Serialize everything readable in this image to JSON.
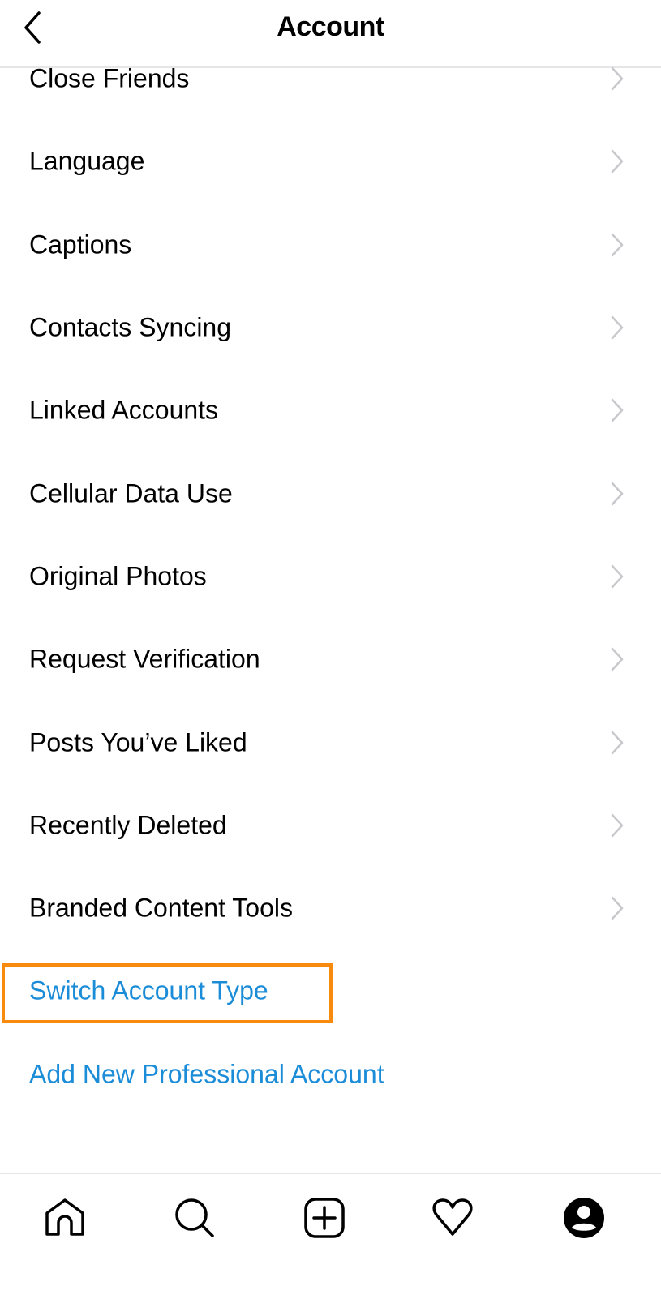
{
  "header": {
    "title": "Account",
    "back_icon": "chevron-left-icon"
  },
  "menu": {
    "items": [
      {
        "label": "Close Friends"
      },
      {
        "label": "Language"
      },
      {
        "label": "Captions"
      },
      {
        "label": "Contacts Syncing"
      },
      {
        "label": "Linked Accounts"
      },
      {
        "label": "Cellular Data Use"
      },
      {
        "label": "Original Photos"
      },
      {
        "label": "Request Verification"
      },
      {
        "label": "Posts You’ve Liked"
      },
      {
        "label": "Recently Deleted"
      },
      {
        "label": "Branded Content Tools"
      }
    ],
    "links": [
      {
        "label": "Switch Account Type",
        "highlighted": true
      },
      {
        "label": "Add New Professional Account"
      }
    ]
  },
  "colors": {
    "link": "#1a8cd8",
    "highlight_border": "#f88a0e",
    "chevron": "#c7c7cc"
  },
  "tabbar": {
    "tabs": [
      {
        "name": "home",
        "icon": "home-icon"
      },
      {
        "name": "search",
        "icon": "search-icon"
      },
      {
        "name": "new-post",
        "icon": "plus-square-icon"
      },
      {
        "name": "activity",
        "icon": "heart-icon"
      },
      {
        "name": "profile",
        "icon": "profile-icon"
      }
    ]
  }
}
